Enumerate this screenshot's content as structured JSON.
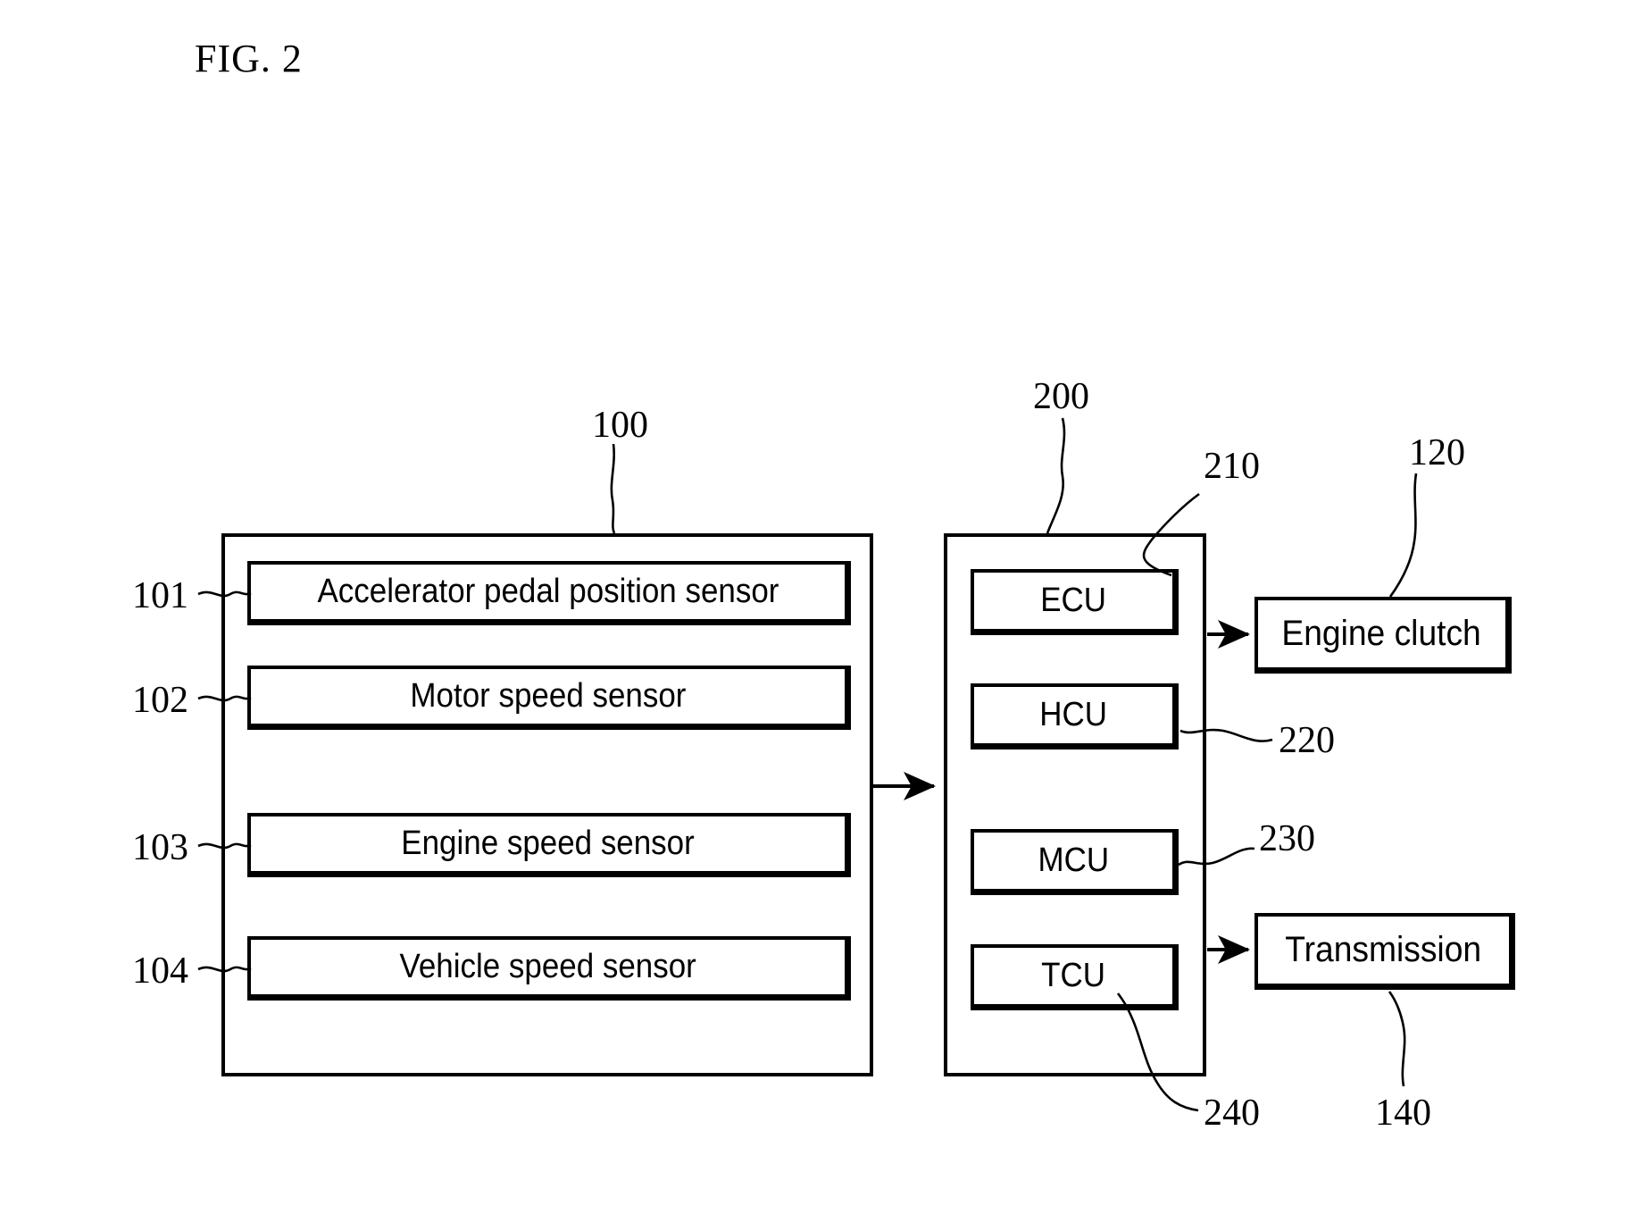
{
  "figure": {
    "title": "FIG. 2"
  },
  "left_unit": {
    "ref": "100",
    "sensors": [
      {
        "ref": "101",
        "label": "Accelerator pedal position sensor"
      },
      {
        "ref": "102",
        "label": "Motor speed sensor"
      },
      {
        "ref": "103",
        "label": "Engine speed sensor"
      },
      {
        "ref": "104",
        "label": "Vehicle speed sensor"
      }
    ]
  },
  "right_unit": {
    "ref": "200",
    "controllers": [
      {
        "ref": "210",
        "label": "ECU"
      },
      {
        "ref": "220",
        "label": "HCU"
      },
      {
        "ref": "230",
        "label": "MCU"
      },
      {
        "ref": "240",
        "label": "TCU"
      }
    ]
  },
  "outputs": [
    {
      "ref": "120",
      "label": "Engine clutch"
    },
    {
      "ref": "140",
      "label": "Transmission"
    }
  ],
  "colors": {
    "ink": "#000000",
    "paper": "#ffffff"
  }
}
